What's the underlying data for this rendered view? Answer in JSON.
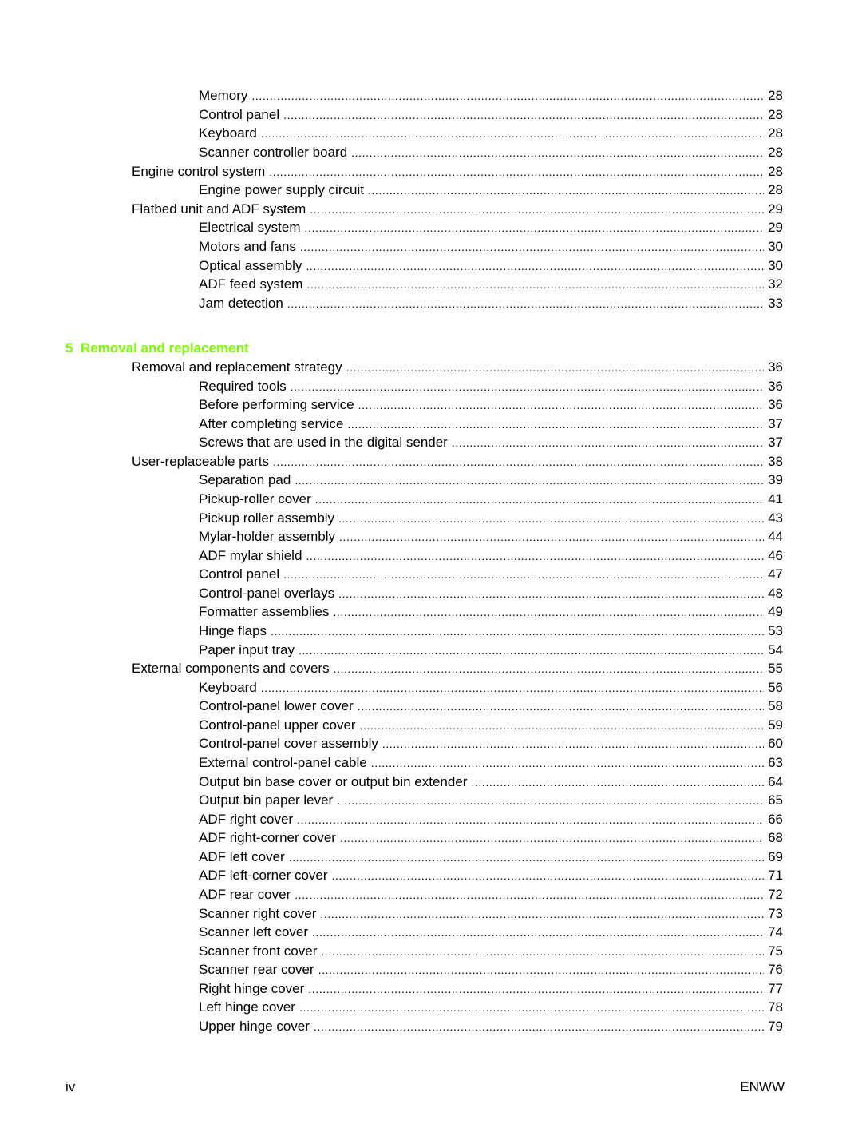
{
  "colors": {
    "chapter_heading": "#7CFC00"
  },
  "block1": [
    {
      "level": 2,
      "title": "Memory",
      "page": "28"
    },
    {
      "level": 2,
      "title": "Control panel",
      "page": "28"
    },
    {
      "level": 2,
      "title": "Keyboard",
      "page": "28"
    },
    {
      "level": 2,
      "title": "Scanner controller board",
      "page": "28"
    },
    {
      "level": 1,
      "title": "Engine control system",
      "page": "28"
    },
    {
      "level": 2,
      "title": "Engine power supply circuit",
      "page": "28"
    },
    {
      "level": 1,
      "title": "Flatbed unit and ADF system",
      "page": "29"
    },
    {
      "level": 2,
      "title": "Electrical system",
      "page": "29"
    },
    {
      "level": 2,
      "title": "Motors and fans",
      "page": "30"
    },
    {
      "level": 2,
      "title": "Optical assembly",
      "page": "30"
    },
    {
      "level": 2,
      "title": "ADF feed system",
      "page": "32"
    },
    {
      "level": 2,
      "title": "Jam detection",
      "page": "33"
    }
  ],
  "chapter": {
    "number": "5",
    "title": "Removal and replacement"
  },
  "block2": [
    {
      "level": 1,
      "title": "Removal and replacement strategy",
      "page": "36"
    },
    {
      "level": 2,
      "title": "Required tools",
      "page": "36"
    },
    {
      "level": 2,
      "title": "Before performing service",
      "page": "36"
    },
    {
      "level": 2,
      "title": "After completing service",
      "page": "37"
    },
    {
      "level": 2,
      "title": "Screws that are used in the digital sender",
      "page": "37"
    },
    {
      "level": 1,
      "title": "User-replaceable parts",
      "page": "38"
    },
    {
      "level": 2,
      "title": "Separation pad",
      "page": "39"
    },
    {
      "level": 2,
      "title": "Pickup-roller cover",
      "page": "41"
    },
    {
      "level": 2,
      "title": "Pickup roller assembly",
      "page": "43"
    },
    {
      "level": 2,
      "title": "Mylar-holder assembly",
      "page": "44"
    },
    {
      "level": 2,
      "title": "ADF mylar shield",
      "page": "46"
    },
    {
      "level": 2,
      "title": "Control panel",
      "page": "47"
    },
    {
      "level": 2,
      "title": "Control-panel overlays",
      "page": "48"
    },
    {
      "level": 2,
      "title": "Formatter assemblies",
      "page": "49"
    },
    {
      "level": 2,
      "title": "Hinge flaps",
      "page": "53"
    },
    {
      "level": 2,
      "title": "Paper input tray",
      "page": "54"
    },
    {
      "level": 1,
      "title": "External components and covers",
      "page": "55"
    },
    {
      "level": 2,
      "title": "Keyboard",
      "page": "56"
    },
    {
      "level": 2,
      "title": "Control-panel lower cover",
      "page": "58"
    },
    {
      "level": 2,
      "title": "Control-panel upper cover",
      "page": "59"
    },
    {
      "level": 2,
      "title": "Control-panel cover assembly",
      "page": "60"
    },
    {
      "level": 2,
      "title": "External control-panel cable",
      "page": "63"
    },
    {
      "level": 2,
      "title": "Output bin base cover or output bin extender",
      "page": "64"
    },
    {
      "level": 2,
      "title": "Output bin paper lever",
      "page": "65"
    },
    {
      "level": 2,
      "title": "ADF right cover",
      "page": "66"
    },
    {
      "level": 2,
      "title": "ADF right-corner cover",
      "page": "68"
    },
    {
      "level": 2,
      "title": "ADF left cover",
      "page": "69"
    },
    {
      "level": 2,
      "title": "ADF left-corner cover",
      "page": "71"
    },
    {
      "level": 2,
      "title": "ADF rear cover",
      "page": "72"
    },
    {
      "level": 2,
      "title": "Scanner right cover",
      "page": "73"
    },
    {
      "level": 2,
      "title": "Scanner left cover",
      "page": "74"
    },
    {
      "level": 2,
      "title": "Scanner front cover",
      "page": "75"
    },
    {
      "level": 2,
      "title": "Scanner rear cover",
      "page": "76"
    },
    {
      "level": 2,
      "title": "Right hinge cover",
      "page": "77"
    },
    {
      "level": 2,
      "title": "Left hinge cover",
      "page": "78"
    },
    {
      "level": 2,
      "title": "Upper hinge cover",
      "page": "79"
    }
  ],
  "footer": {
    "left": "iv",
    "right": "ENWW"
  }
}
